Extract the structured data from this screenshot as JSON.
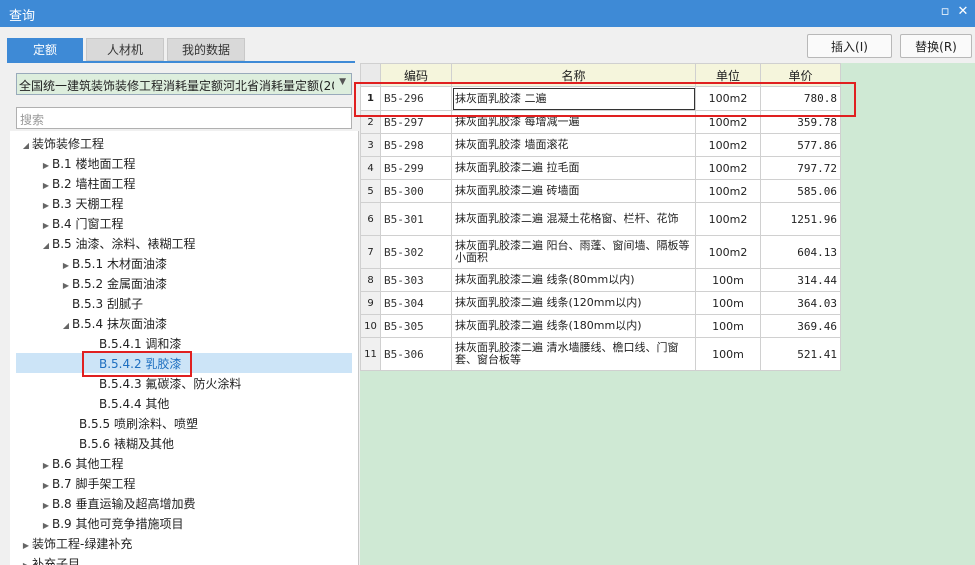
{
  "window": {
    "title": "查询"
  },
  "tabs": [
    {
      "label": "定额"
    },
    {
      "label": "人材机"
    },
    {
      "label": "我的数据"
    }
  ],
  "buttons": {
    "insert": "插入(I)",
    "replace": "替换(R)"
  },
  "library_select": {
    "value": "全国统一建筑装饰装修工程消耗量定额河北省消耗量定额(20"
  },
  "search": {
    "placeholder": "搜索"
  },
  "tree": [
    {
      "label": "装饰装修工程"
    },
    {
      "label": "B.1 楼地面工程"
    },
    {
      "label": "B.2 墙柱面工程"
    },
    {
      "label": "B.3 天棚工程"
    },
    {
      "label": "B.4 门窗工程"
    },
    {
      "label": "B.5 油漆、涂料、裱糊工程"
    },
    {
      "label": "B.5.1 木材面油漆"
    },
    {
      "label": "B.5.2 金属面油漆"
    },
    {
      "label": "B.5.3 刮腻子"
    },
    {
      "label": "B.5.4 抹灰面油漆"
    },
    {
      "label": "B.5.4.1 调和漆"
    },
    {
      "label": "B.5.4.2 乳胶漆"
    },
    {
      "label": "B.5.4.3 氟碳漆、防火涂料"
    },
    {
      "label": "B.5.4.4 其他"
    },
    {
      "label": "B.5.5 喷刷涂料、喷塑"
    },
    {
      "label": "B.5.6 裱糊及其他"
    },
    {
      "label": "B.6 其他工程"
    },
    {
      "label": "B.7 脚手架工程"
    },
    {
      "label": "B.8 垂直运输及超高增加费"
    },
    {
      "label": "B.9 其他可竞争措施项目"
    },
    {
      "label": "装饰工程-绿建补充"
    },
    {
      "label": "补充子目"
    }
  ],
  "table": {
    "columns": [
      "编码",
      "名称",
      "单位",
      "单价"
    ],
    "rows": [
      {
        "no": "1",
        "code": "B5-296",
        "name": "抹灰面乳胶漆 二遍",
        "unit": "100m2",
        "price": "780.8"
      },
      {
        "no": "2",
        "code": "B5-297",
        "name": "抹灰面乳胶漆 每增减一遍",
        "unit": "100m2",
        "price": "359.78"
      },
      {
        "no": "3",
        "code": "B5-298",
        "name": "抹灰面乳胶漆 墙面滚花",
        "unit": "100m2",
        "price": "577.86"
      },
      {
        "no": "4",
        "code": "B5-299",
        "name": "抹灰面乳胶漆二遍 拉毛面",
        "unit": "100m2",
        "price": "797.72"
      },
      {
        "no": "5",
        "code": "B5-300",
        "name": "抹灰面乳胶漆二遍 砖墙面",
        "unit": "100m2",
        "price": "585.06"
      },
      {
        "no": "6",
        "code": "B5-301",
        "name": "抹灰面乳胶漆二遍 混凝土花格窗、栏杆、花饰",
        "unit": "100m2",
        "price": "1251.96"
      },
      {
        "no": "7",
        "code": "B5-302",
        "name": "抹灰面乳胶漆二遍 阳台、雨蓬、窗间墙、隔板等小面积",
        "unit": "100m2",
        "price": "604.13"
      },
      {
        "no": "8",
        "code": "B5-303",
        "name": "抹灰面乳胶漆二遍 线条(80mm以内)",
        "unit": "100m",
        "price": "314.44"
      },
      {
        "no": "9",
        "code": "B5-304",
        "name": "抹灰面乳胶漆二遍 线条(120mm以内)",
        "unit": "100m",
        "price": "364.03"
      },
      {
        "no": "10",
        "code": "B5-305",
        "name": "抹灰面乳胶漆二遍 线条(180mm以内)",
        "unit": "100m",
        "price": "369.46"
      },
      {
        "no": "11",
        "code": "B5-306",
        "name": "抹灰面乳胶漆二遍 清水墙腰线、檐口线、门窗套、窗台板等",
        "unit": "100m",
        "price": "521.41"
      }
    ]
  },
  "colors": {
    "accent": "#3e8ad6",
    "highlight": "#e02020",
    "grid_bg": "#cfe9d4"
  }
}
